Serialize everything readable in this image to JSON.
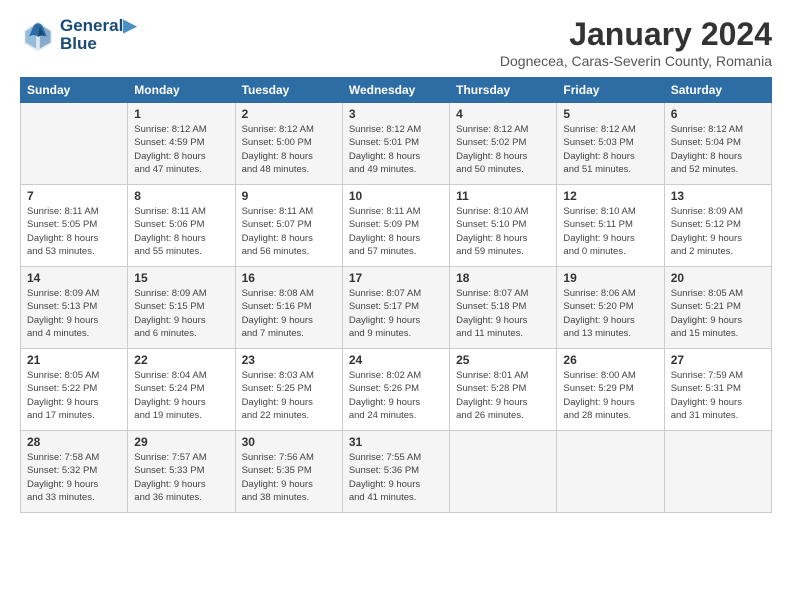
{
  "logo": {
    "line1": "General",
    "line2": "Blue"
  },
  "title": "January 2024",
  "subtitle": "Dognecea, Caras-Severin County, Romania",
  "days_of_week": [
    "Sunday",
    "Monday",
    "Tuesday",
    "Wednesday",
    "Thursday",
    "Friday",
    "Saturday"
  ],
  "weeks": [
    [
      {
        "day": "",
        "info": ""
      },
      {
        "day": "1",
        "info": "Sunrise: 8:12 AM\nSunset: 4:59 PM\nDaylight: 8 hours\nand 47 minutes."
      },
      {
        "day": "2",
        "info": "Sunrise: 8:12 AM\nSunset: 5:00 PM\nDaylight: 8 hours\nand 48 minutes."
      },
      {
        "day": "3",
        "info": "Sunrise: 8:12 AM\nSunset: 5:01 PM\nDaylight: 8 hours\nand 49 minutes."
      },
      {
        "day": "4",
        "info": "Sunrise: 8:12 AM\nSunset: 5:02 PM\nDaylight: 8 hours\nand 50 minutes."
      },
      {
        "day": "5",
        "info": "Sunrise: 8:12 AM\nSunset: 5:03 PM\nDaylight: 8 hours\nand 51 minutes."
      },
      {
        "day": "6",
        "info": "Sunrise: 8:12 AM\nSunset: 5:04 PM\nDaylight: 8 hours\nand 52 minutes."
      }
    ],
    [
      {
        "day": "7",
        "info": "Sunrise: 8:11 AM\nSunset: 5:05 PM\nDaylight: 8 hours\nand 53 minutes."
      },
      {
        "day": "8",
        "info": "Sunrise: 8:11 AM\nSunset: 5:06 PM\nDaylight: 8 hours\nand 55 minutes."
      },
      {
        "day": "9",
        "info": "Sunrise: 8:11 AM\nSunset: 5:07 PM\nDaylight: 8 hours\nand 56 minutes."
      },
      {
        "day": "10",
        "info": "Sunrise: 8:11 AM\nSunset: 5:09 PM\nDaylight: 8 hours\nand 57 minutes."
      },
      {
        "day": "11",
        "info": "Sunrise: 8:10 AM\nSunset: 5:10 PM\nDaylight: 8 hours\nand 59 minutes."
      },
      {
        "day": "12",
        "info": "Sunrise: 8:10 AM\nSunset: 5:11 PM\nDaylight: 9 hours\nand 0 minutes."
      },
      {
        "day": "13",
        "info": "Sunrise: 8:09 AM\nSunset: 5:12 PM\nDaylight: 9 hours\nand 2 minutes."
      }
    ],
    [
      {
        "day": "14",
        "info": "Sunrise: 8:09 AM\nSunset: 5:13 PM\nDaylight: 9 hours\nand 4 minutes."
      },
      {
        "day": "15",
        "info": "Sunrise: 8:09 AM\nSunset: 5:15 PM\nDaylight: 9 hours\nand 6 minutes."
      },
      {
        "day": "16",
        "info": "Sunrise: 8:08 AM\nSunset: 5:16 PM\nDaylight: 9 hours\nand 7 minutes."
      },
      {
        "day": "17",
        "info": "Sunrise: 8:07 AM\nSunset: 5:17 PM\nDaylight: 9 hours\nand 9 minutes."
      },
      {
        "day": "18",
        "info": "Sunrise: 8:07 AM\nSunset: 5:18 PM\nDaylight: 9 hours\nand 11 minutes."
      },
      {
        "day": "19",
        "info": "Sunrise: 8:06 AM\nSunset: 5:20 PM\nDaylight: 9 hours\nand 13 minutes."
      },
      {
        "day": "20",
        "info": "Sunrise: 8:05 AM\nSunset: 5:21 PM\nDaylight: 9 hours\nand 15 minutes."
      }
    ],
    [
      {
        "day": "21",
        "info": "Sunrise: 8:05 AM\nSunset: 5:22 PM\nDaylight: 9 hours\nand 17 minutes."
      },
      {
        "day": "22",
        "info": "Sunrise: 8:04 AM\nSunset: 5:24 PM\nDaylight: 9 hours\nand 19 minutes."
      },
      {
        "day": "23",
        "info": "Sunrise: 8:03 AM\nSunset: 5:25 PM\nDaylight: 9 hours\nand 22 minutes."
      },
      {
        "day": "24",
        "info": "Sunrise: 8:02 AM\nSunset: 5:26 PM\nDaylight: 9 hours\nand 24 minutes."
      },
      {
        "day": "25",
        "info": "Sunrise: 8:01 AM\nSunset: 5:28 PM\nDaylight: 9 hours\nand 26 minutes."
      },
      {
        "day": "26",
        "info": "Sunrise: 8:00 AM\nSunset: 5:29 PM\nDaylight: 9 hours\nand 28 minutes."
      },
      {
        "day": "27",
        "info": "Sunrise: 7:59 AM\nSunset: 5:31 PM\nDaylight: 9 hours\nand 31 minutes."
      }
    ],
    [
      {
        "day": "28",
        "info": "Sunrise: 7:58 AM\nSunset: 5:32 PM\nDaylight: 9 hours\nand 33 minutes."
      },
      {
        "day": "29",
        "info": "Sunrise: 7:57 AM\nSunset: 5:33 PM\nDaylight: 9 hours\nand 36 minutes."
      },
      {
        "day": "30",
        "info": "Sunrise: 7:56 AM\nSunset: 5:35 PM\nDaylight: 9 hours\nand 38 minutes."
      },
      {
        "day": "31",
        "info": "Sunrise: 7:55 AM\nSunset: 5:36 PM\nDaylight: 9 hours\nand 41 minutes."
      },
      {
        "day": "",
        "info": ""
      },
      {
        "day": "",
        "info": ""
      },
      {
        "day": "",
        "info": ""
      }
    ]
  ]
}
